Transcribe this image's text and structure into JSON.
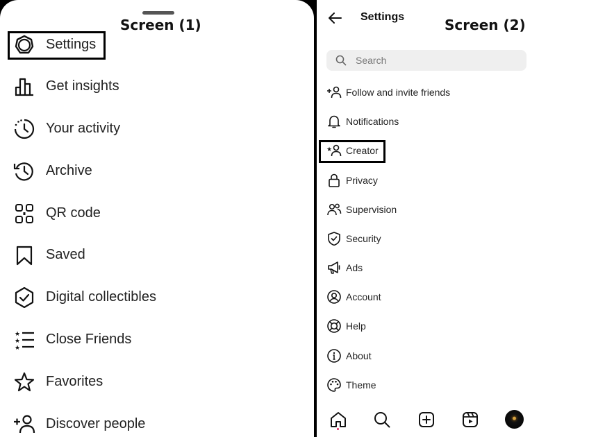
{
  "screen1": {
    "label": "Screen (1)",
    "items": [
      {
        "label": "Settings",
        "icon": "settings-gear-icon"
      },
      {
        "label": "Get insights",
        "icon": "insights-chart-icon"
      },
      {
        "label": "Your activity",
        "icon": "activity-clock-icon"
      },
      {
        "label": "Archive",
        "icon": "archive-history-icon"
      },
      {
        "label": "QR code",
        "icon": "qr-code-icon"
      },
      {
        "label": "Saved",
        "icon": "bookmark-icon"
      },
      {
        "label": "Digital collectibles",
        "icon": "check-shield-icon"
      },
      {
        "label": "Close Friends",
        "icon": "star-list-icon"
      },
      {
        "label": "Favorites",
        "icon": "star-icon"
      },
      {
        "label": "Discover people",
        "icon": "add-person-icon"
      }
    ]
  },
  "screen2": {
    "label": "Screen (2)",
    "title": "Settings",
    "search_placeholder": "Search",
    "items": [
      {
        "label": "Follow and invite friends",
        "icon": "add-person-icon"
      },
      {
        "label": "Notifications",
        "icon": "bell-icon"
      },
      {
        "label": "Creator",
        "icon": "creator-star-person-icon"
      },
      {
        "label": "Privacy",
        "icon": "lock-icon"
      },
      {
        "label": "Supervision",
        "icon": "people-icon"
      },
      {
        "label": "Security",
        "icon": "shield-icon"
      },
      {
        "label": "Ads",
        "icon": "megaphone-icon"
      },
      {
        "label": "Account",
        "icon": "account-circle-icon"
      },
      {
        "label": "Help",
        "icon": "lifebuoy-icon"
      },
      {
        "label": "About",
        "icon": "info-icon"
      },
      {
        "label": "Theme",
        "icon": "palette-icon"
      }
    ],
    "bottom_nav": [
      {
        "name": "home",
        "icon": "home-icon"
      },
      {
        "name": "search",
        "icon": "search-icon"
      },
      {
        "name": "create",
        "icon": "plus-square-icon"
      },
      {
        "name": "reels",
        "icon": "reels-icon"
      },
      {
        "name": "profile",
        "icon": "avatar"
      }
    ],
    "accent_color": "#e0245e"
  }
}
